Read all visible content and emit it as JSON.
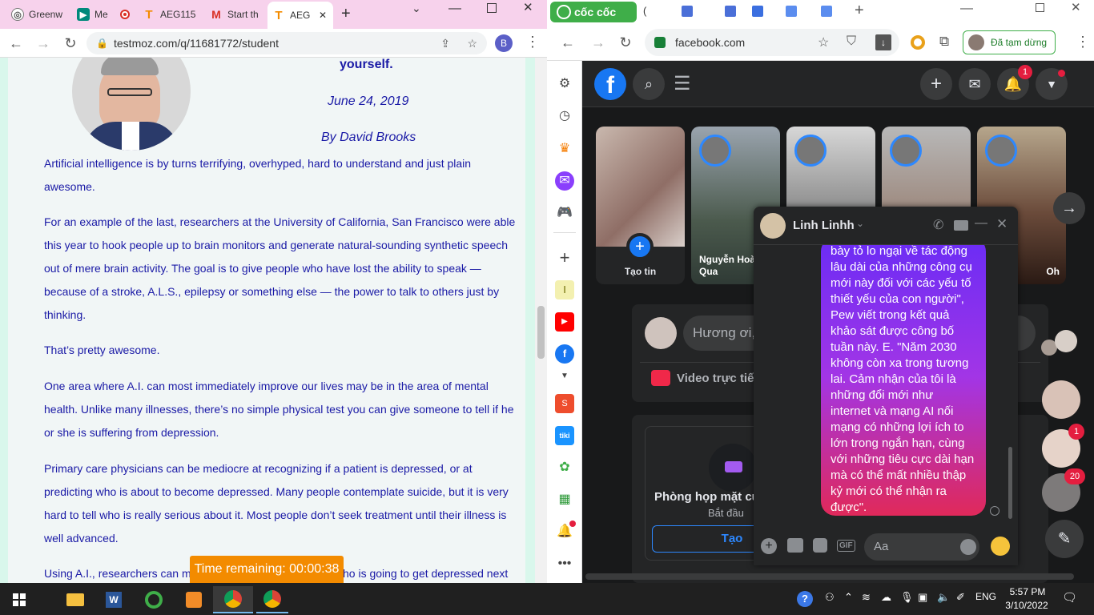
{
  "left_browser": {
    "tabs": [
      {
        "label": "Greenw",
        "icon": "globe-icon",
        "color": "#555555"
      },
      {
        "label": "Me",
        "icon": "meet-icon",
        "color": "#00897b"
      },
      {
        "label": "AEG115",
        "icon": "testmoz-icon",
        "color": "#f38b00"
      },
      {
        "label": "Start th",
        "icon": "gmail-icon",
        "color": "#d93025"
      },
      {
        "label": "AEG",
        "icon": "testmoz-icon",
        "color": "#f38b00"
      }
    ],
    "url": "testmoz.com/q/11681772/student",
    "profile_initial": "B",
    "article": {
      "heading_tail": "yourself.",
      "date": "June 24, 2019",
      "byline": "By David Brooks",
      "paragraphs": [
        "Artificial intelligence is by turns terrifying, overhyped, hard to understand and just plain awesome.",
        "For an example of the last, researchers at the University of California, San Francisco were able this year to hook people up to brain monitors and generate natural-sounding synthetic speech out of mere brain activity. The goal is to give people who have lost the ability to speak — because of a stroke, A.L.S., epilepsy or something else — the power to talk to others just by thinking.",
        "That’s pretty awesome.",
        "One area where A.I. can most immediately improve our lives may be in the area of mental health. Unlike many illnesses, there’s no simple physical test you can give someone to tell if he or she is suffering from depression.",
        "Primary care physicians can be mediocre at recognizing if a patient is depressed, or at predicting who is about to become depressed. Many people contemplate suicide, but it is very hard to tell who is really serious about it. Most people don’t seek treatment until their illness is well advanced.",
        "Using A.I., researchers can m",
        "ho is going to get depressed next"
      ]
    },
    "timer": "Time remaining: 00:00:38"
  },
  "right_browser": {
    "brand": "cốc cốc",
    "url": "facebook.com",
    "paused_label": "Đã tạm dừng",
    "facebook": {
      "notif_count": "1",
      "stories": [
        {
          "name": "Tạo tin"
        },
        {
          "name": "Nguyễn Hoàng Qua"
        },
        {
          "name": ""
        },
        {
          "name": ""
        },
        {
          "name": "Oh"
        }
      ],
      "composer_placeholder": "Hương ơi,",
      "video_label": "Video trực tiếp",
      "room_title": "Phòng họp mặt củ",
      "room_sub": "Bắt đầu",
      "room_button": "Tạo",
      "contact_badges": [
        "1",
        "20"
      ]
    },
    "chat": {
      "name": "Linh Linhh",
      "message": "bày tỏ lo ngại về tác động lâu dài của những công cụ mới này đối với các yếu tố thiết yếu của con người\", Pew viết trong kết quả khảo sát được công bố tuần này.  E. \"Năm 2030 không còn xa trong tương lai. Cảm nhận của tôi là những đổi mới như internet và mạng AI nối mạng có những lợi ích to lớn trong ngắn hạn, cùng với những tiêu cực dài hạn mà có thể mất nhiều thập kỷ mới có thể nhận ra được\".",
      "input_placeholder": "Aa"
    }
  },
  "taskbar": {
    "lang": "ENG",
    "time": "5:57 PM",
    "date": "3/10/2022"
  }
}
